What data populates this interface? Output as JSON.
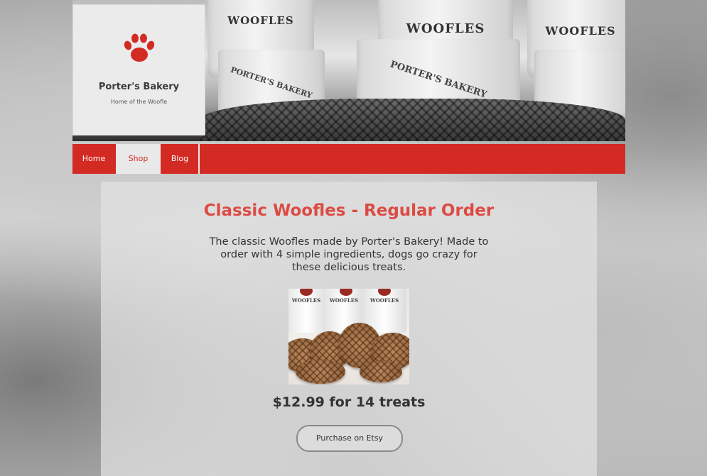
{
  "logo": {
    "title": "Porter's Bakery",
    "tagline": "Home of the Woofle",
    "icon": "paw-icon"
  },
  "banner": {
    "cup_label": "WOOFLES",
    "cup_brand": "PORTER'S BAKERY"
  },
  "nav": {
    "items": [
      {
        "label": "Home",
        "active": false
      },
      {
        "label": "Shop",
        "active": true
      },
      {
        "label": "Blog",
        "active": false
      }
    ]
  },
  "product": {
    "title": "Classic Woofles - Regular Order",
    "description": "The classic Woofles made by Porter's Bakery! Made to order with 4 simple ingredients, dogs go crazy for these delicious treats.",
    "image_cup_label": "WOOFLES",
    "price": "$12.99",
    "price_detail": "for 14 treats",
    "buy_label": "Purchase on Etsy"
  },
  "colors": {
    "brand_red": "#d42a24",
    "title_red": "#dc4a44"
  }
}
